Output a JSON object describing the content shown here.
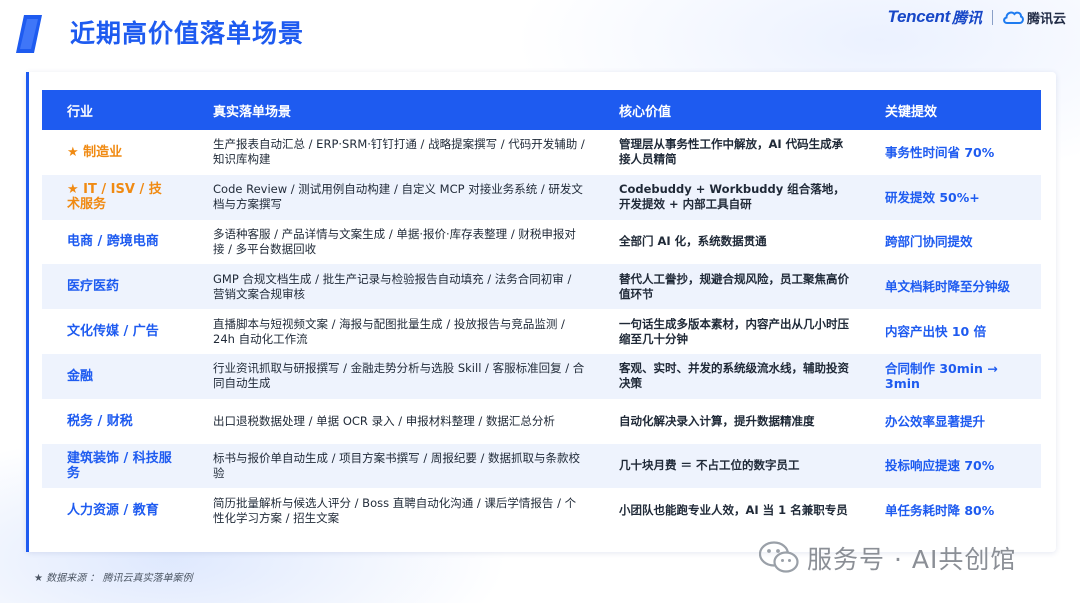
{
  "header": {
    "title": "近期高价值落单场景",
    "brand_en": "Tencent",
    "brand_cn": "腾讯",
    "brand_cloud": "腾讯云"
  },
  "table": {
    "columns": [
      "行业",
      "真实落单场景",
      "核心价值",
      "关键提效"
    ],
    "rows": [
      {
        "industry": "★ 制造业",
        "star": true,
        "scenario": "生产报表自动汇总 / ERP·SRM·钉钉打通 / 战略提案撰写 / 代码开发辅助 / 知识库构建",
        "value": "管理层从事务性工作中解放，AI 代码生成承接人员精简",
        "efficiency": "事务性时间省 70%"
      },
      {
        "industry": "★ IT / ISV / 技术服务",
        "star": true,
        "scenario": "Code Review / 测试用例自动构建 / 自定义 MCP 对接业务系统 / 研发文档与方案撰写",
        "value": "Codebuddy + Workbuddy 组合落地，开发提效 + 内部工具自研",
        "efficiency": "研发提效 50%+"
      },
      {
        "industry": "电商 / 跨境电商",
        "star": false,
        "scenario": "多语种客服 / 产品详情与文案生成 / 单据·报价·库存表整理 / 财税申报对接 / 多平台数据回收",
        "value": "全部门 AI 化，系统数据贯通",
        "efficiency": "跨部门协同提效"
      },
      {
        "industry": "医疗医药",
        "star": false,
        "scenario": "GMP 合规文档生成 / 批生产记录与检验报告自动填充 / 法务合同初审 / 营销文案合规审核",
        "value": "替代人工誊抄，规避合规风险，员工聚焦高价值环节",
        "efficiency": "单文档耗时降至分钟级"
      },
      {
        "industry": "文化传媒 / 广告",
        "star": false,
        "scenario": "直播脚本与短视频文案 / 海报与配图批量生成 / 投放报告与竞品监测 / 24h 自动化工作流",
        "value": "一句话生成多版本素材，内容产出从几小时压缩至几十分钟",
        "efficiency": "内容产出快 10 倍"
      },
      {
        "industry": "金融",
        "star": false,
        "scenario": "行业资讯抓取与研报撰写 / 金融走势分析与选股 Skill / 客服标准回复 / 合同自动生成",
        "value": "客观、实时、并发的系统级流水线，辅助投资决策",
        "efficiency": "合同制作 30min → 3min"
      },
      {
        "industry": "税务 / 财税",
        "star": false,
        "scenario": "出口退税数据处理 / 单据 OCR 录入 / 申报材料整理 / 数据汇总分析",
        "value": "自动化解决录入计算，提升数据精准度",
        "efficiency": "办公效率显著提升"
      },
      {
        "industry": "建筑装饰 / 科技服务",
        "star": false,
        "scenario": "标书与报价单自动生成 / 项目方案书撰写 / 周报纪要 / 数据抓取与条款校验",
        "value": "几十块月费 ＝ 不占工位的数字员工",
        "efficiency": "投标响应提速 70%"
      },
      {
        "industry": "人力资源 / 教育",
        "star": false,
        "scenario": "简历批量解析与候选人评分 / Boss 直聘自动化沟通 / 课后学情报告 / 个性化学习方案 / 招生文案",
        "value": "小团队也能跑专业人效，AI 当 1 名兼职专员",
        "efficiency": "单任务耗时降 80%"
      }
    ]
  },
  "footer": {
    "source": "★ 数据来源 ： 腾讯云真实落单案例",
    "watermark": "服务号 · AI共创馆"
  },
  "colors": {
    "primary": "#1e5bf0",
    "star": "#f08a12",
    "row_alt": "#eef3fd"
  },
  "icons": [
    "logo-mark-icon",
    "cloud-icon",
    "wechat-icon"
  ]
}
